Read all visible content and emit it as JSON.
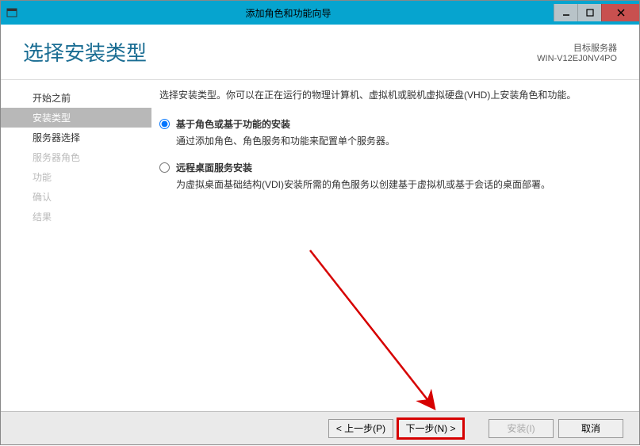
{
  "titlebar": {
    "title": "添加角色和功能向导"
  },
  "header": {
    "title": "选择安装类型",
    "target_label": "目标服务器",
    "target_server": "WIN-V12EJ0NV4PO"
  },
  "sidebar": {
    "items": [
      {
        "label": "开始之前",
        "state": "normal"
      },
      {
        "label": "安装类型",
        "state": "active"
      },
      {
        "label": "服务器选择",
        "state": "normal"
      },
      {
        "label": "服务器角色",
        "state": "disabled"
      },
      {
        "label": "功能",
        "state": "disabled"
      },
      {
        "label": "确认",
        "state": "disabled"
      },
      {
        "label": "结果",
        "state": "disabled"
      }
    ]
  },
  "main": {
    "intro": "选择安装类型。你可以在正在运行的物理计算机、虚拟机或脱机虚拟硬盘(VHD)上安装角色和功能。",
    "options": [
      {
        "title": "基于角色或基于功能的安装",
        "desc": "通过添加角色、角色服务和功能来配置单个服务器。",
        "checked": true
      },
      {
        "title": "远程桌面服务安装",
        "desc": "为虚拟桌面基础结构(VDI)安装所需的角色服务以创建基于虚拟机或基于会话的桌面部署。",
        "checked": false
      }
    ]
  },
  "footer": {
    "prev": "< 上一步(P)",
    "next": "下一步(N) >",
    "install": "安装(I)",
    "cancel": "取消"
  }
}
